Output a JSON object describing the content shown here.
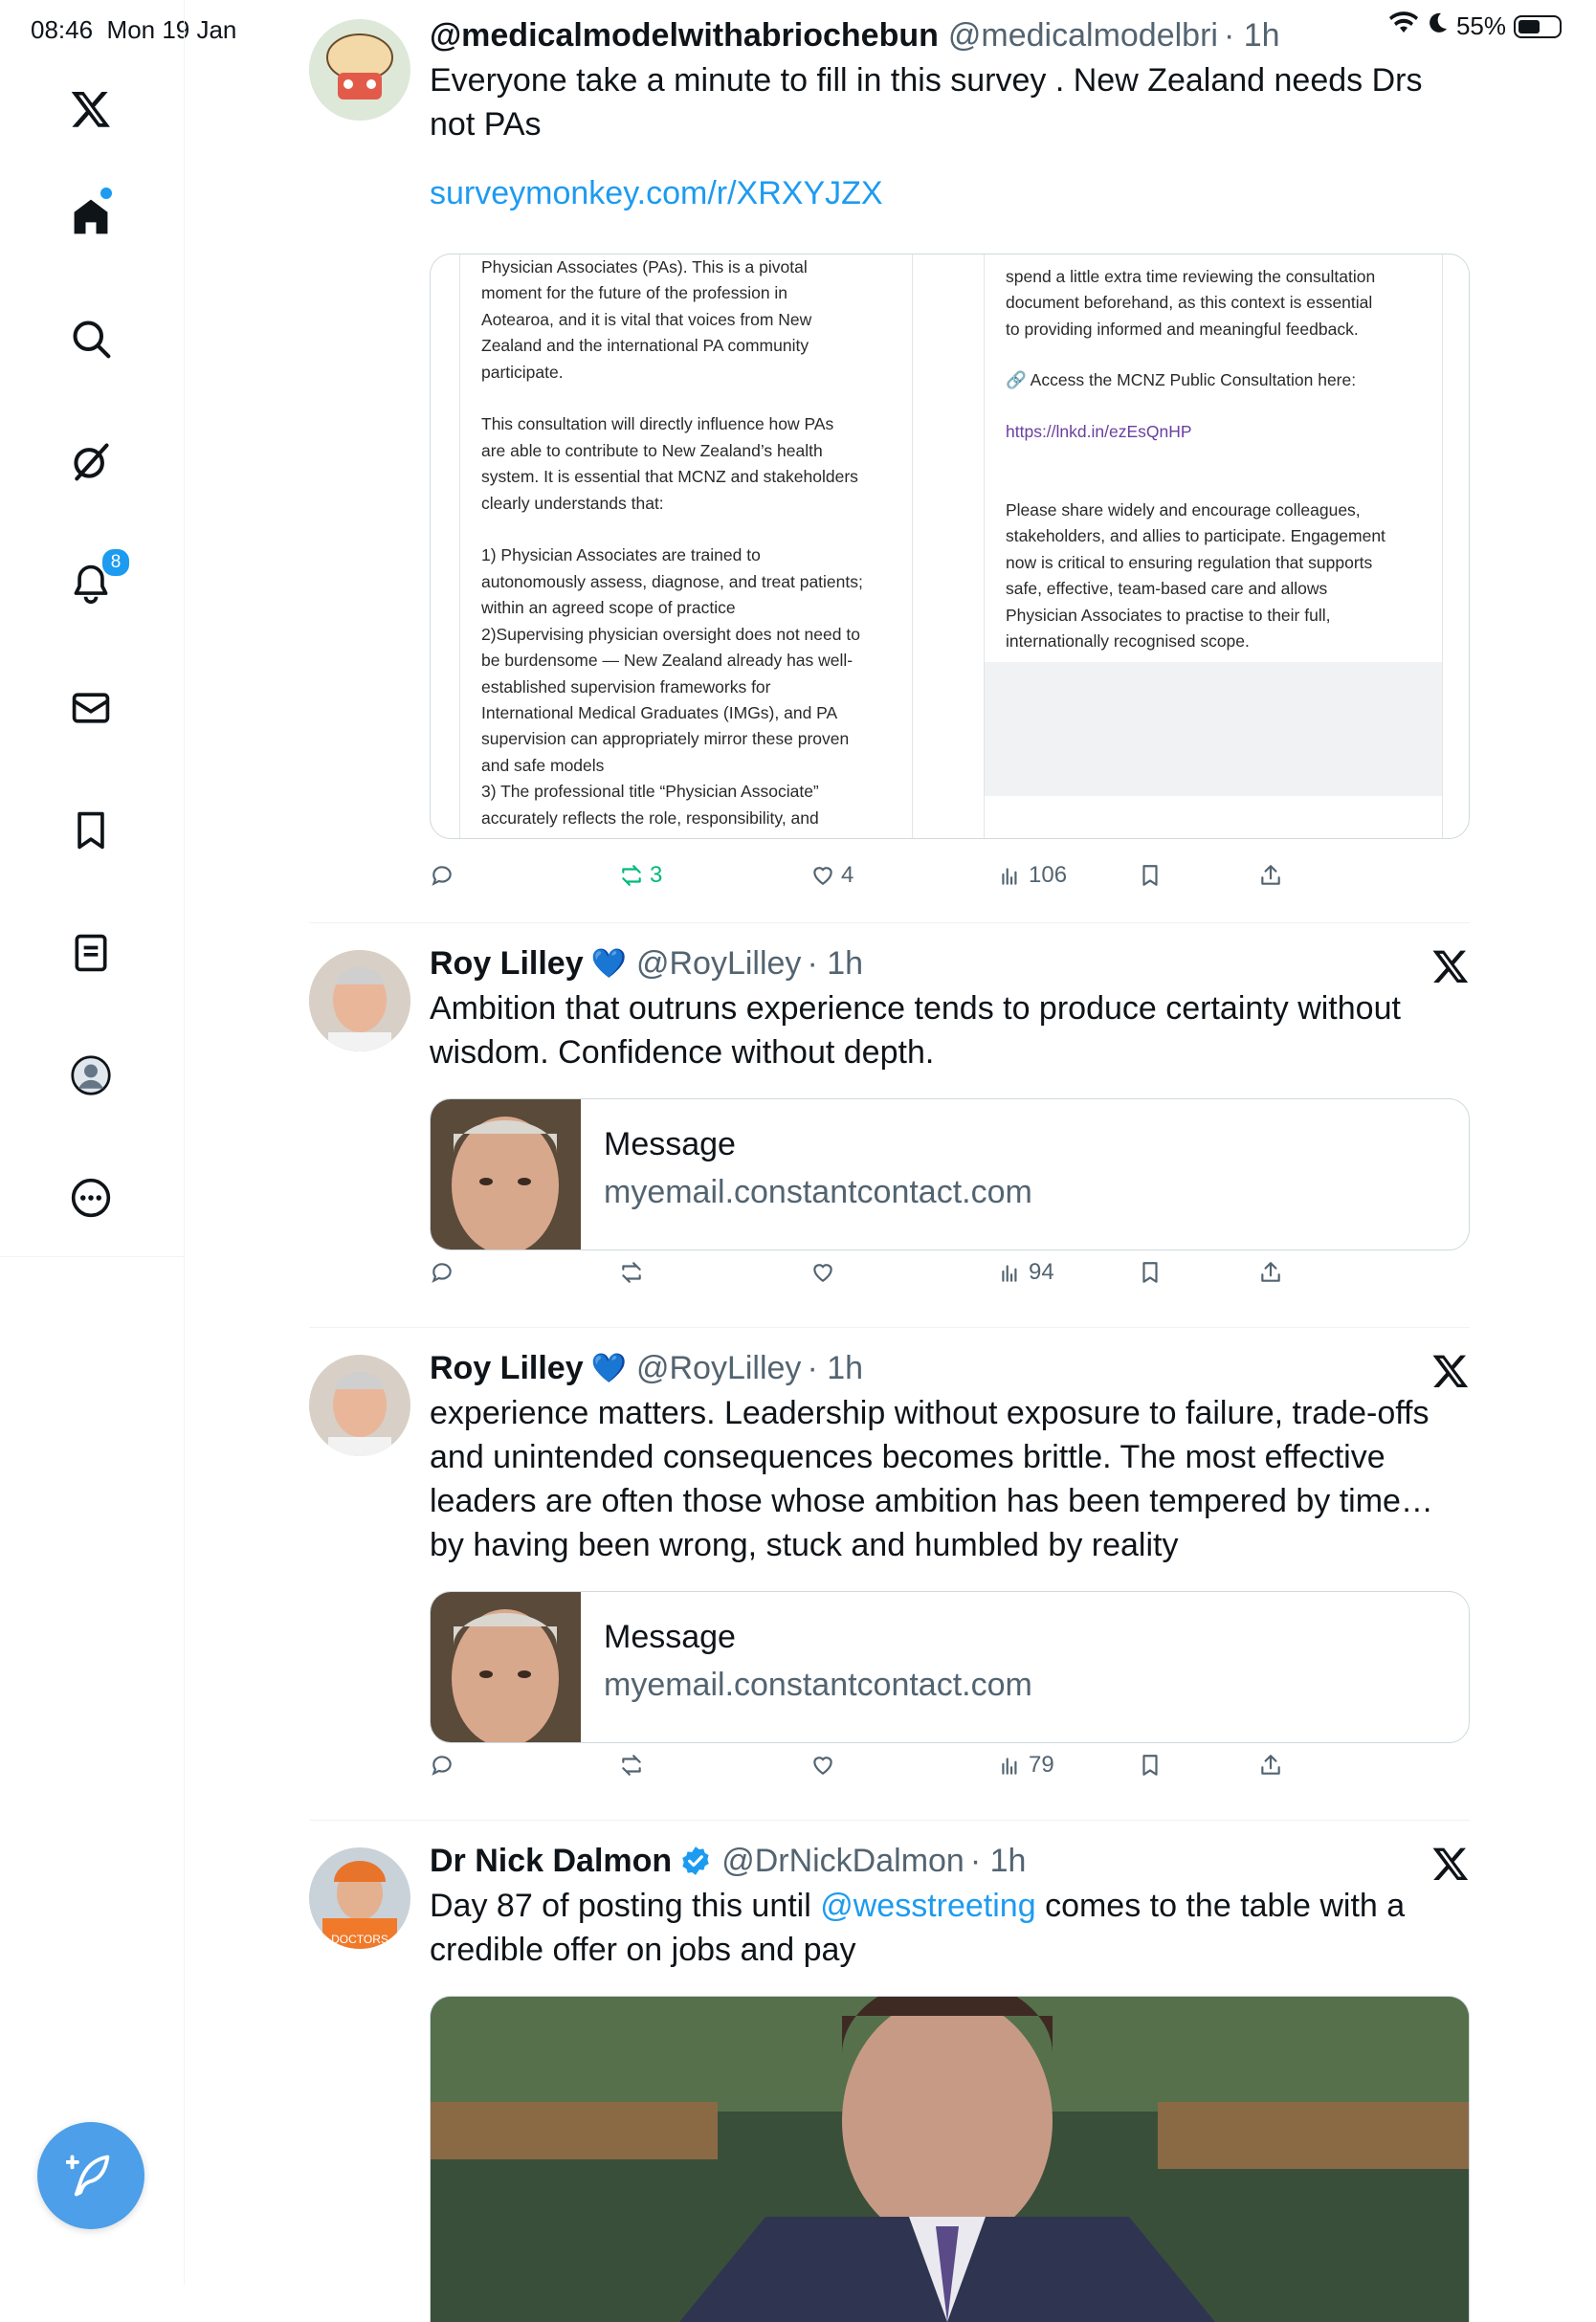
{
  "status_bar": {
    "time": "08:46",
    "date": "Mon 19 Jan",
    "battery": "55%"
  },
  "sidebar": {
    "notifications_count": "8"
  },
  "tweets": [
    {
      "author_name": "@medicalmodelwithabriochebun",
      "handle": "@medicalmodelbri",
      "time": "1h",
      "text": "Everyone take a minute to fill in this survey . New Zealand needs Drs not PAs",
      "link": "surveymonkey.com/r/XRXYJZX",
      "doc_left_text": "Physician Associates (PAs). This is a pivotal\nmoment for the future of the profession in\nAotearoa, and it is vital that voices from New\nZealand and the international PA community\nparticipate.\n\nThis consultation will directly influence how PAs\nare able to contribute to New Zealand’s health\nsystem. It is essential that MCNZ and stakeholders\nclearly understands that:\n\n1) Physician Associates are trained to\nautonomously assess, diagnose, and treat patients;\nwithin an agreed scope of practice\n2)Supervising physician oversight does not need to\nbe burdensome — New Zealand already has well-\nestablished supervision frameworks for\nInternational Medical Graduates (IMGs), and PA\nsupervision can appropriately mirror these proven\nand safe models\n3) The professional title “Physician Associate”\naccurately reflects the role, responsibility, and",
      "doc_right_top": "spend a little extra time reviewing the consultation\ndocument beforehand, as this context is essential\nto providing informed and meaningful feedback.",
      "doc_right_access": "🔗 Access the MCNZ Public Consultation here:",
      "doc_right_link": "https://lnkd.in/ezEsQnHP",
      "doc_right_bottom": "Please share widely and encourage colleagues,\nstakeholders, and allies to participate. Engagement\nnow is critical to ensuring regulation that supports\nsafe, effective, team-based care and allows\nPhysician Associates to practise to their full,\ninternationally recognised scope.",
      "retweets": "3",
      "likes": "4",
      "views": "106"
    },
    {
      "author_name": "Roy Lilley",
      "handle": "@RoyLilley",
      "time": "1h",
      "text": "Ambition that outruns experience tends to produce certainty without wisdom. Confidence without depth.",
      "card_title": "Message",
      "card_domain": "myemail.constantcontact.com",
      "views": "94"
    },
    {
      "author_name": "Roy Lilley",
      "handle": "@RoyLilley",
      "time": "1h",
      "text": "experience matters. Leadership without exposure to failure, trade-offs and unintended consequences becomes brittle. The most effective leaders are often those whose ambition has been tempered by time… by having been wrong, stuck and humbled by reality",
      "card_title": "Message",
      "card_domain": "myemail.constantcontact.com",
      "views": "79"
    },
    {
      "author_name": "Dr Nick Dalmon",
      "handle": "@DrNickDalmon",
      "time": "1h",
      "text_before": "Day 87 of posting this until ",
      "mention": "@wesstreeting",
      "text_after": " comes to the table with a credible offer on jobs and pay"
    }
  ],
  "colors": {
    "accent": "#1d9bf0",
    "retweet_green": "#00ba7c",
    "secondary_text": "#536471",
    "fab": "#4c9fe8"
  },
  "icons": [
    "x-logo-icon",
    "home-icon",
    "search-icon",
    "grok-icon",
    "bell-icon",
    "mail-icon",
    "bookmark-icon",
    "list-icon",
    "profile-icon",
    "more-icon",
    "compose-icon",
    "reply-icon",
    "retweet-icon",
    "like-icon",
    "views-icon",
    "bookmark-icon",
    "share-icon",
    "verified-icon",
    "x-close-icon"
  ]
}
